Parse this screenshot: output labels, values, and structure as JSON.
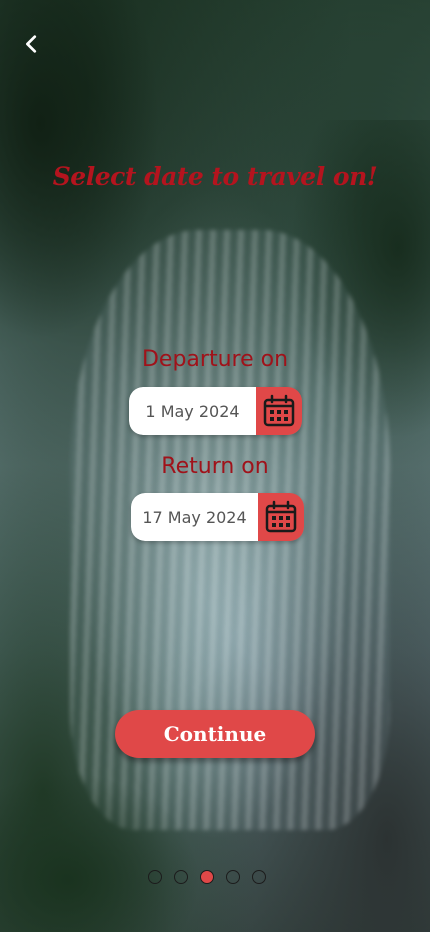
{
  "header": {
    "back_icon": "chevron-left-icon"
  },
  "title": "Select date to travel on!",
  "departure": {
    "label": "Departure on",
    "value": "1 May 2024",
    "icon": "calendar-icon"
  },
  "return": {
    "label": "Return on",
    "value": "17 May 2024",
    "icon": "calendar-icon"
  },
  "continue_label": "Continue",
  "pagination": {
    "total": 5,
    "active_index": 2
  },
  "colors": {
    "accent": "#e04848",
    "title": "#b4141e",
    "label": "#a0121a"
  }
}
